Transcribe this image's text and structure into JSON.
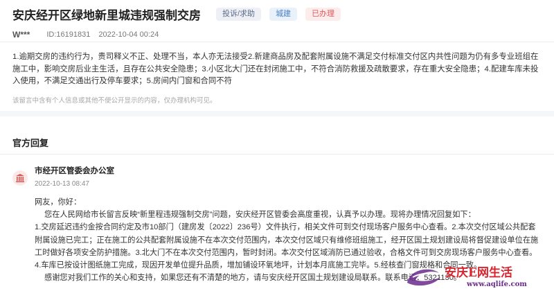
{
  "post": {
    "title": "安庆经开区绿地新里城违规强制交房",
    "tags": {
      "category": "投诉/求助",
      "field": "城建",
      "status": "已办理"
    },
    "author": "W***",
    "message_id": "ID:16191831",
    "timestamp": "2022-10-04 00:24",
    "content": "1.逾期交房的违约行为，贵司释义不正、处理不当，本人亦无法接受2.新建商品房及配套附属设施不满足交付标准交付区内共性问题为仍有多专业班组在施工中，影响交房后业主生活，且存在公共安全隐患；3.小区北大门还在封闭施工中，不符合消防救援及疏散要求，存在重大安全隐患；4.配建车库未投入使用，不满足交通出行及停车要求；5.房间内门窗和合同不符",
    "disclaimer": "该留言中含有个人信息或其他不便公开显示的内容，仅办理机构可见。"
  },
  "reply_section": {
    "title": "官方回复",
    "org_name": "市经开区管委会办公室",
    "org_icon": "government-building-icon",
    "timestamp": "2022-10-13 08:47",
    "greeting": "网友，你好：",
    "paragraphs": [
      "您在人民网给市长留言反映“新里程违规强制交房”问题，安庆经开区管委会高度重视，认真予以办理。现将办理情况回复如下：",
      "1.交房延迟违约金按合同约定及市10部门（建房发〔2022〕236号）文件执行，相关文件可到交付现场客户服务中心查看。2.本次交付区域公共配套附属设施已完工；正在施工的公共配套附属设施不在本次交付范围内，本次交付区域只有维修班组施工，经开区国土规划建设局将督促建设单位在施工时做好各项安全防护措施。3.北大门不在本次交付范围内，暂时封闭。本次交付区域消防已通过验收，合格文件可到交房现场客户服务中心查看。4.车库已按设计图纸施工完成，现因开发单位提升品质，增加铺设环氧地坪，计划本月底施工完毕。5.经核查门窗规格和合同一致。",
      "感谢您对我们工作的关心和支持，如果您还有不清楚的地方，请与安庆经开区国土规划建设局联系。联系电话：5321130。"
    ]
  },
  "watermark": {
    "brand": "安庆E网生活",
    "url": "www.aqlife.com"
  },
  "colors": {
    "status_red": "#e05a5a",
    "field_blue": "#4a7fc1",
    "watermark_purple": "#6a2c8c",
    "watermark_red": "#d9232d"
  }
}
